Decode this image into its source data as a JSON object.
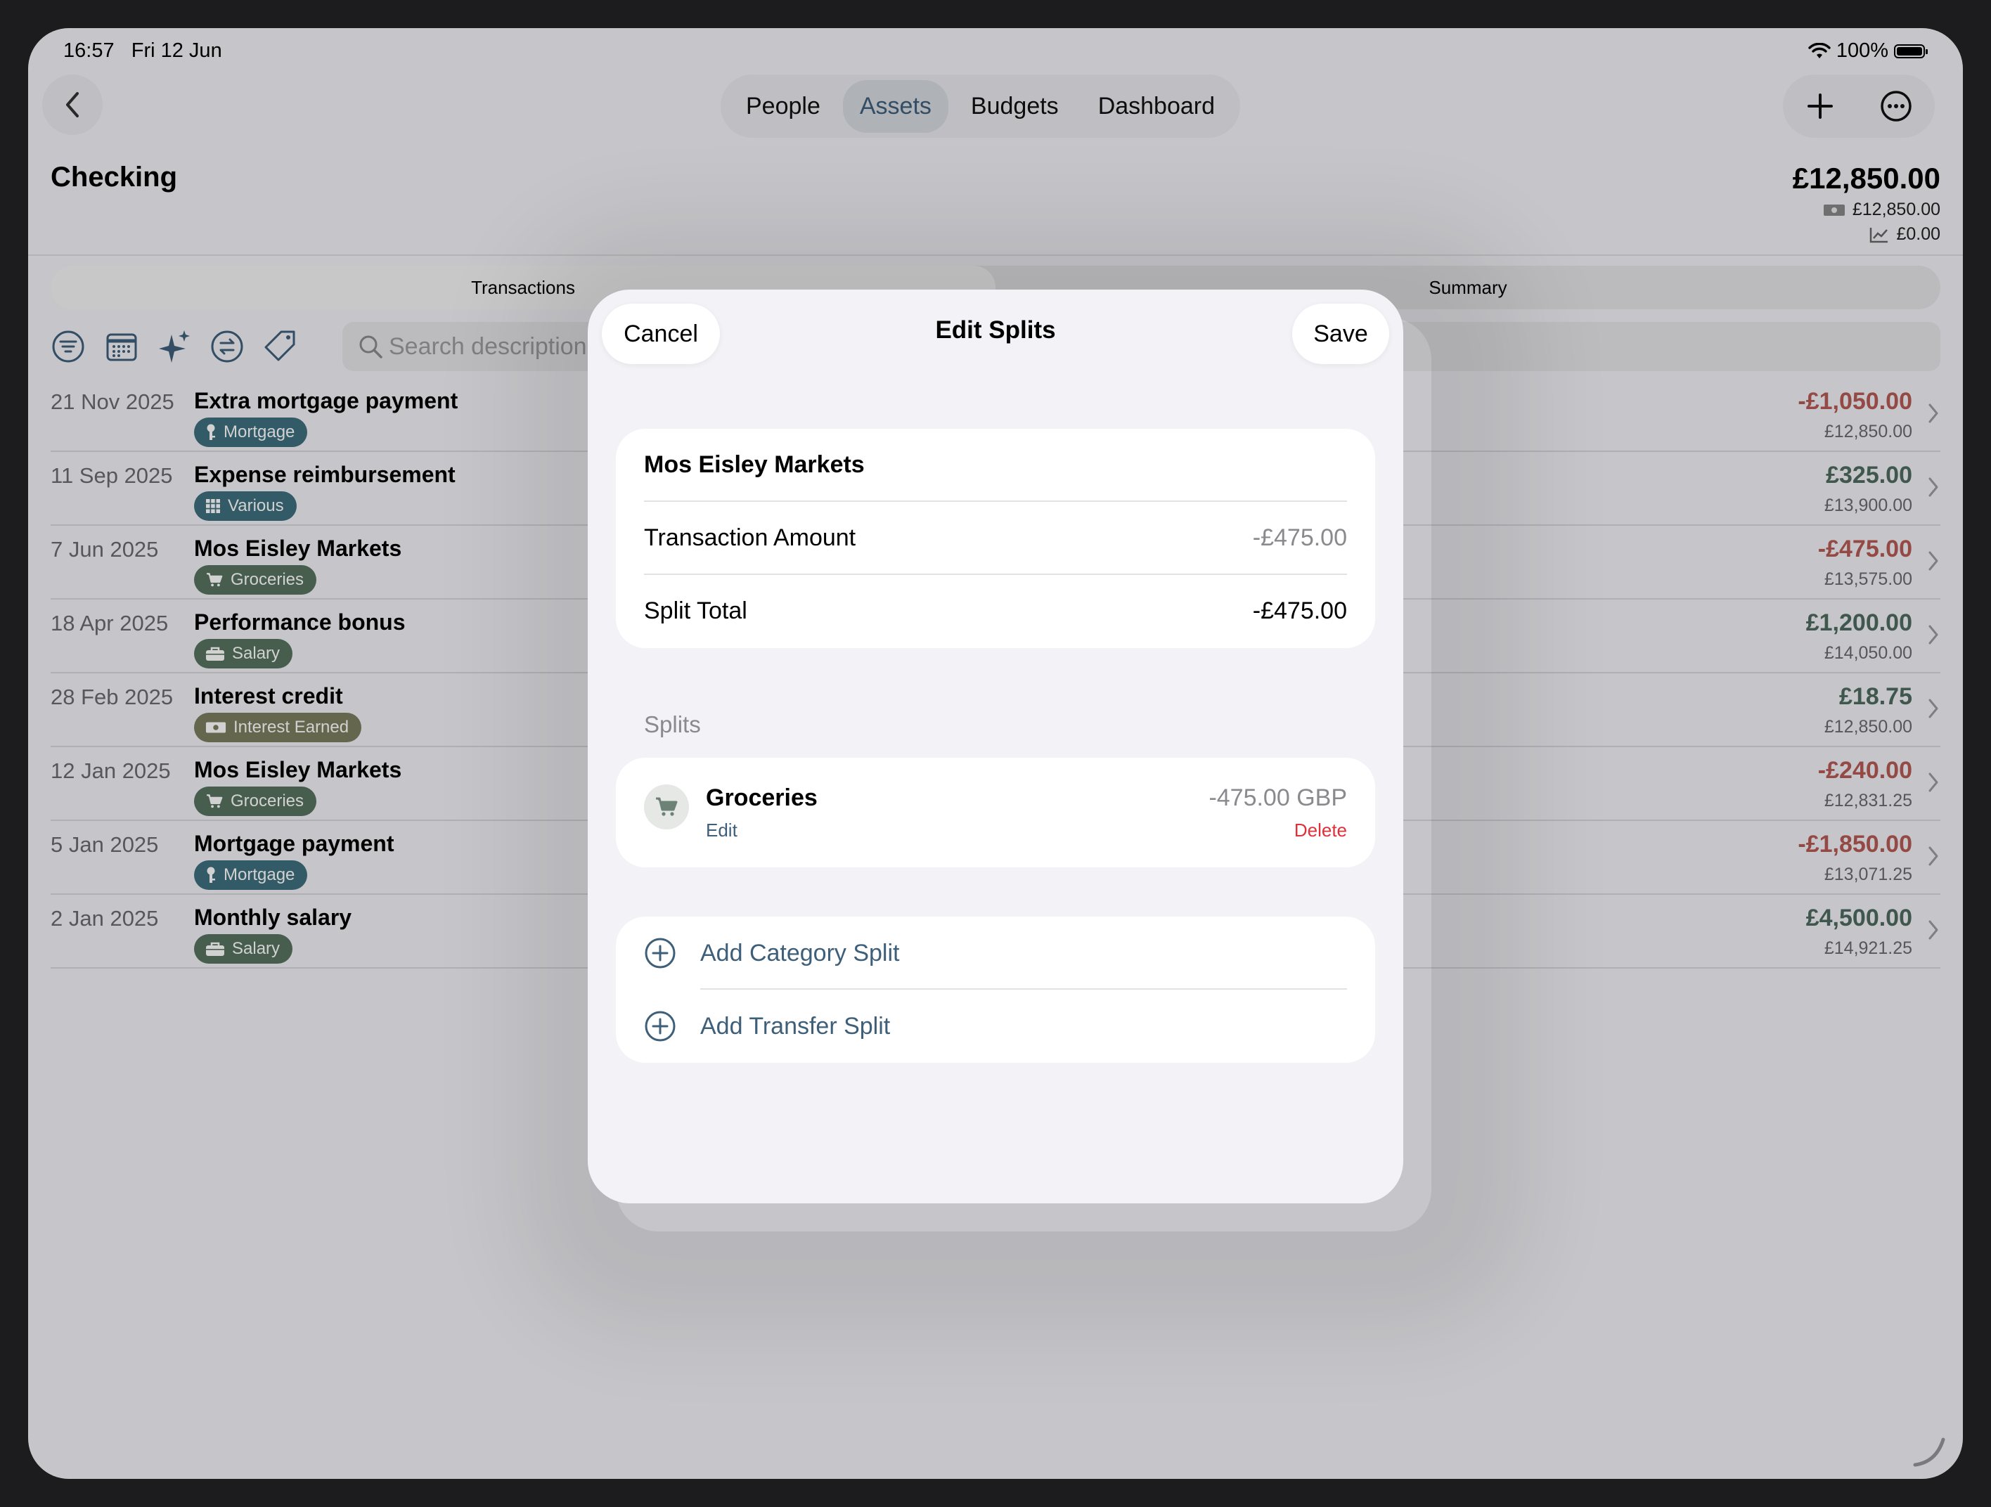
{
  "status": {
    "time": "16:57",
    "date": "Fri 12 Jun",
    "battery": "100%"
  },
  "nav": {
    "back_icon": "chevron-left-icon",
    "segments": [
      "People",
      "Assets",
      "Budgets",
      "Dashboard"
    ],
    "active_segment": "Assets",
    "add_icon": "plus-icon",
    "more_icon": "ellipsis-circle-icon"
  },
  "account": {
    "title": "Checking",
    "balance": "£12,850.00",
    "cash_balance": "£12,850.00",
    "invest_balance": "£0.00"
  },
  "tabs": {
    "transactions": "Transactions",
    "summary": "Summary"
  },
  "toolbar": {
    "icons": [
      "filter-icon",
      "calendar-icon",
      "sparkles-icon",
      "currency-exchange-icon",
      "tag-icon"
    ],
    "search_placeholder": "Search description or"
  },
  "transactions": [
    {
      "date": "21 Nov 2025",
      "name": "Extra mortgage payment",
      "tag": "Mortgage",
      "tag_icon": "key-icon",
      "tag_color": "#3e6f7e",
      "amount": "-£1,050.00",
      "balance": "£12,850.00",
      "negative": true
    },
    {
      "date": "11 Sep 2025",
      "name": "Expense reimbursement",
      "tag": "Various",
      "tag_icon": "grid-icon",
      "tag_color": "#3e6f7e",
      "amount": "£325.00",
      "balance": "£13,900.00",
      "negative": false
    },
    {
      "date": "7 Jun 2025",
      "name": "Mos Eisley Markets",
      "tag": "Groceries",
      "tag_icon": "cart-icon",
      "tag_color": "#57725f",
      "amount": "-£475.00",
      "balance": "£13,575.00",
      "negative": true
    },
    {
      "date": "18 Apr 2025",
      "name": "Performance bonus",
      "tag": "Salary",
      "tag_icon": "briefcase-icon",
      "tag_color": "#57725f",
      "amount": "£1,200.00",
      "balance": "£14,050.00",
      "negative": false
    },
    {
      "date": "28 Feb 2025",
      "name": "Interest credit",
      "tag": "Interest Earned",
      "tag_icon": "banknote-icon",
      "tag_color": "#7a7e5e",
      "amount": "£18.75",
      "balance": "£12,850.00",
      "negative": false
    },
    {
      "date": "12 Jan 2025",
      "name": "Mos Eisley Markets",
      "tag": "Groceries",
      "tag_icon": "cart-icon",
      "tag_color": "#57725f",
      "amount": "-£240.00",
      "balance": "£12,831.25",
      "negative": true
    },
    {
      "date": "5 Jan 2025",
      "name": "Mortgage payment",
      "tag": "Mortgage",
      "tag_icon": "key-icon",
      "tag_color": "#3e6f7e",
      "amount": "-£1,850.00",
      "balance": "£13,071.25",
      "negative": true
    },
    {
      "date": "2 Jan 2025",
      "name": "Monthly salary",
      "tag": "Salary",
      "tag_icon": "briefcase-icon",
      "tag_color": "#57725f",
      "amount": "£4,500.00",
      "balance": "£14,921.25",
      "negative": false
    }
  ],
  "colors": {
    "negative": "#b65a55",
    "positive": "#4f6b5e",
    "accent": "#3e5f7a",
    "delete": "#e0313a"
  },
  "modal": {
    "cancel": "Cancel",
    "title": "Edit Splits",
    "save": "Save",
    "payee": "Mos Eisley Markets",
    "transaction_amount_label": "Transaction Amount",
    "transaction_amount": "-£475.00",
    "split_total_label": "Split Total",
    "split_total": "-£475.00",
    "splits_header": "Splits",
    "splits": [
      {
        "category": "Groceries",
        "icon": "cart-icon",
        "amount": "-475.00 GBP",
        "edit": "Edit",
        "delete": "Delete"
      }
    ],
    "add_category": "Add Category Split",
    "add_transfer": "Add Transfer Split"
  }
}
